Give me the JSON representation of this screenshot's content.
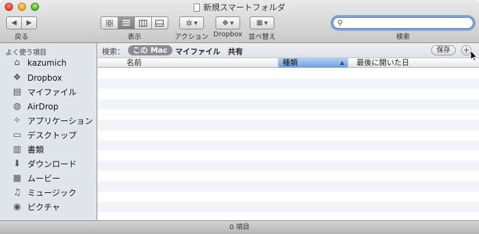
{
  "window": {
    "title": "新規スマートフォルダ"
  },
  "toolbar": {
    "back_label": "戻る",
    "view_label": "表示",
    "action_label": "アクション",
    "dropbox_label": "Dropbox",
    "arrange_label": "並べ替え",
    "search_label": "検索",
    "search_value": ""
  },
  "sidebar": {
    "header": "よく使う項目",
    "items": [
      {
        "label": "kazumich",
        "icon": "home-icon"
      },
      {
        "label": "Dropbox",
        "icon": "dropbox-icon"
      },
      {
        "label": "マイファイル",
        "icon": "all-my-files-icon"
      },
      {
        "label": "AirDrop",
        "icon": "airdrop-icon"
      },
      {
        "label": "アプリケーション",
        "icon": "applications-icon"
      },
      {
        "label": "デスクトップ",
        "icon": "desktop-icon"
      },
      {
        "label": "書類",
        "icon": "documents-icon"
      },
      {
        "label": "ダウンロード",
        "icon": "downloads-icon"
      },
      {
        "label": "ムービー",
        "icon": "movies-icon"
      },
      {
        "label": "ミュージック",
        "icon": "music-icon"
      },
      {
        "label": "ピクチャ",
        "icon": "pictures-icon"
      }
    ]
  },
  "search_scope": {
    "label": "検索：",
    "this_mac": "この Mac",
    "my_files": "マイファイル",
    "shared": "共有",
    "save": "保存"
  },
  "columns": {
    "name": "名前",
    "kind": "種類",
    "last_opened": "最後に開いた日"
  },
  "status": {
    "text": "0 項目"
  },
  "colors": {
    "accent": "#6a9ce0",
    "sidebar_bg": "#e1e6ed",
    "row_alt": "#f1f5fa"
  }
}
